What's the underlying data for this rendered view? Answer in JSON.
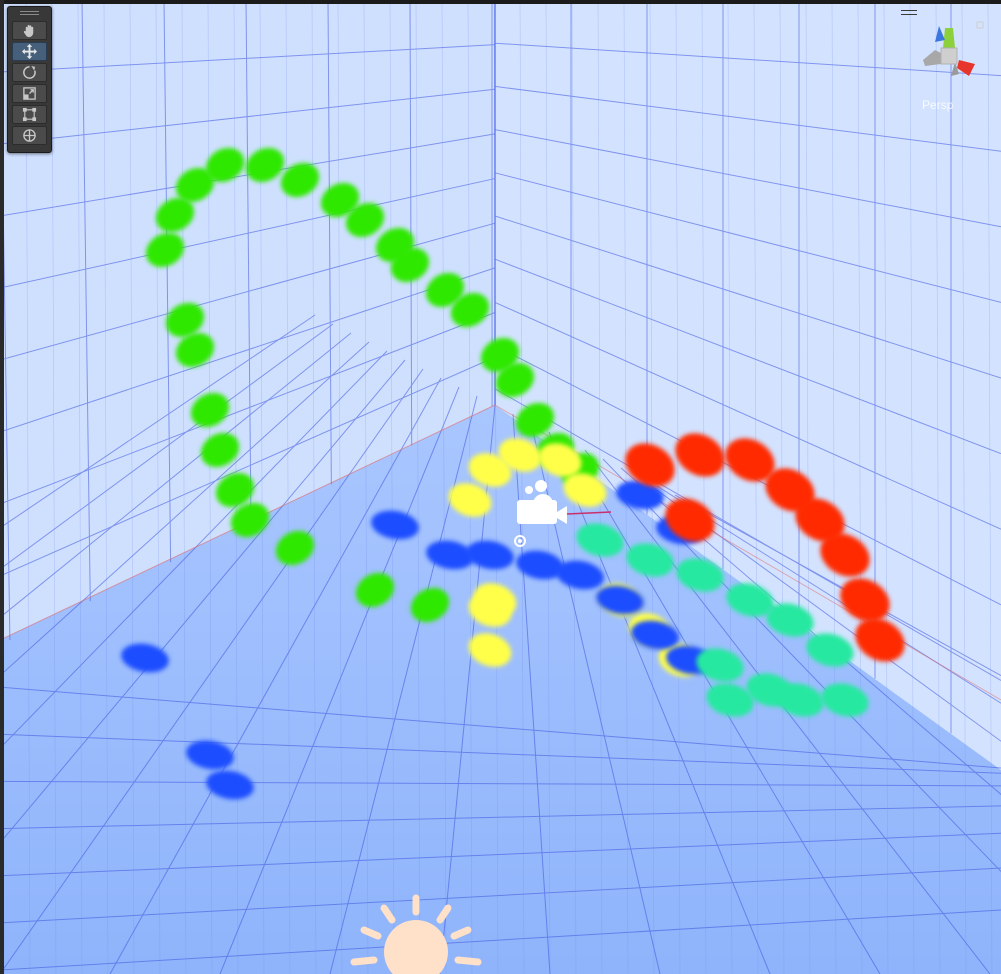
{
  "scene_view": {
    "projection_label": "Persp",
    "background_color": "#cfe0ff",
    "grid_color": "#3f55e0"
  },
  "tool_palette": {
    "tools": [
      {
        "name": "hand-tool",
        "icon": "hand-icon",
        "active": false
      },
      {
        "name": "move-tool",
        "icon": "move-arrows-icon",
        "active": true
      },
      {
        "name": "rotate-tool",
        "icon": "rotate-icon",
        "active": false
      },
      {
        "name": "scale-tool",
        "icon": "scale-icon",
        "active": false
      },
      {
        "name": "rect-tool",
        "icon": "rect-transform-icon",
        "active": false
      },
      {
        "name": "transform-tool",
        "icon": "transform-icon",
        "active": false
      }
    ]
  },
  "gizmo": {
    "axis_colors": {
      "x": "#e8352b",
      "y": "#8cd13c",
      "z": "#3a78e0"
    }
  },
  "particles": {
    "colors": [
      "#2de800",
      "#ffff4a",
      "#1a4dff",
      "#ff2a00",
      "#25e8a0"
    ]
  },
  "scene_icons": [
    "camera-gizmo-icon",
    "directional-light-icon",
    "particle-emitter-icon"
  ]
}
